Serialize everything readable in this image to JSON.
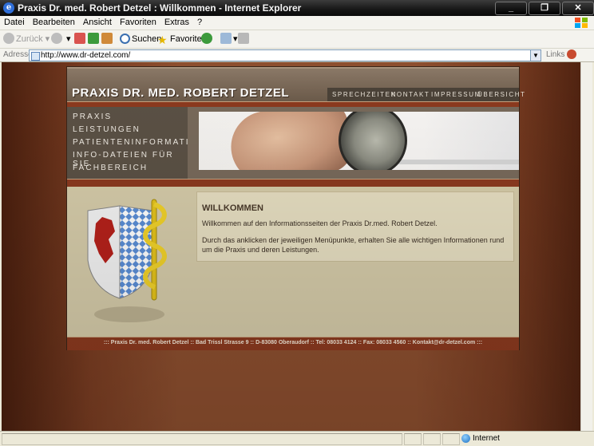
{
  "window": {
    "title": "Praxis Dr. med. Robert Detzel : Willkommen - Internet Explorer",
    "app_icon": "ie-logo-icon",
    "buttons": [
      "minimize-icon",
      "maximize-icon",
      "close-icon"
    ]
  },
  "menu": [
    "Datei",
    "Bearbeiten",
    "Ansicht",
    "Favoriten",
    "Extras",
    "?"
  ],
  "toolbar": {
    "back": "Zurück",
    "search": "Suchen",
    "favorites": "Favoriten"
  },
  "address": {
    "label": "Adresse",
    "url": "http://www.dr-detzel.com/",
    "links": "Links"
  },
  "site": {
    "title": "PRAXIS DR. MED. ROBERT DETZEL",
    "topnav": [
      "SPRECHZEITEN",
      "KONTAKT",
      "IMPRESSUM",
      "ÜBERSICHT"
    ],
    "leftnav": [
      "PRAXIS",
      "LEISTUNGEN",
      "PATIENTENINFORMATION",
      "INFO-DATEIEN FÜR SIE",
      "FACHBEREICH"
    ],
    "welcome": {
      "heading": "WILLKOMMEN",
      "p1": "Willkommen auf den Informationsseiten der Praxis Dr.med. Robert Detzel.",
      "p2": "Durch das anklicken der jeweiligen Menüpunkte, erhalten Sie alle wichtigen Informationen rund um die Praxis und deren Leistungen."
    },
    "footer": "::: Praxis Dr. med. Robert Detzel :: Bad Trissl Strasse 9 :: D-83080 Oberaudorf :: Tel: 08033 4124 :: Fax: 08033 4560 :: Kontakt@dr-detzel.com :::"
  },
  "status": {
    "zone": "Internet"
  },
  "colors": {
    "background_brown": "#8d4f2f",
    "accent_red": "#8c3a1f",
    "panel_dark": "#5b5145",
    "content_beige": "#d5cba9"
  }
}
